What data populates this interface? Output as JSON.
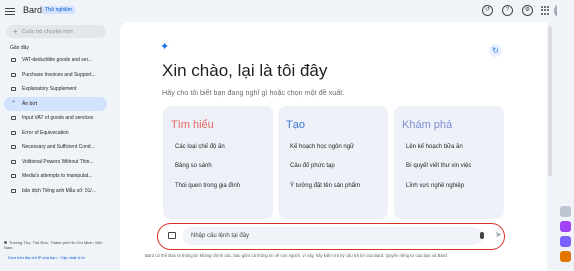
{
  "header": {
    "brand": "Bard",
    "badge": "Thử nghiệm",
    "icons": [
      "menu-icon",
      "history-icon",
      "help-icon",
      "settings-icon",
      "apps-icon",
      "avatar"
    ]
  },
  "sidebar": {
    "new_chat": "Cuộc trò chuyện mới",
    "recent_title": "Gần đây",
    "items": [
      {
        "label": "VAT-deductible goods and ser..."
      },
      {
        "label": "Purchase Invoices and Support..."
      },
      {
        "label": "Explanatory Supplement"
      },
      {
        "label": "Ẩn bớt",
        "active": true
      },
      {
        "label": "Input VAT of goods and services"
      },
      {
        "label": "Error of Equivocation"
      },
      {
        "label": "Necessary and Sufficient Cond..."
      },
      {
        "label": "Volitional Powers Without Thin..."
      },
      {
        "label": "Media's attempts to manipulat..."
      },
      {
        "label": "bản dịch Tiếng anh Mẫu số: 01/..."
      }
    ],
    "location": "Trường Thọ, Thủ Đức, Thành phố Hồ Chí Minh, Việt Nam",
    "location_links": "Dựa trên địa chỉ IP của bạn · Cập nhật vị trí"
  },
  "main": {
    "greeting": "Xin chào, lại là tôi đây",
    "subtitle": "Hãy cho tôi biết bạn đang nghĩ gì hoặc chọn một đề xuất.",
    "cards": [
      {
        "title": "Tìm hiểu",
        "items": [
          "Các loại chế độ ăn",
          "Bảng so sánh",
          "Thói quen trong gia đình"
        ]
      },
      {
        "title": "Tạo",
        "items": [
          "Kế hoạch học ngôn ngữ",
          "Câu đố phức tạp",
          "Ý tưởng đặt tên sản phẩm"
        ]
      },
      {
        "title": "Khám phá",
        "items": [
          "Lên kế hoạch bữa ăn",
          "Bí quyết viết thư xin việc",
          "Lĩnh vực nghề nghiệp"
        ]
      }
    ],
    "input_placeholder": "Nhập câu lệnh tại đây",
    "disclaimer": "Bard có thể đưa ra thông tin không chính xác, bao gồm cả thông tin về con người, vì vậy, hãy kiểm tra kỹ câu trả lời của Bard. Quyền riêng tư của bạn và Bard"
  },
  "colors": {
    "learn": "#e46962",
    "create": "#3e7bd8",
    "explore": "#7f8cd6",
    "input_highlight": "#d93025",
    "active_item": "#d3e3fd"
  }
}
